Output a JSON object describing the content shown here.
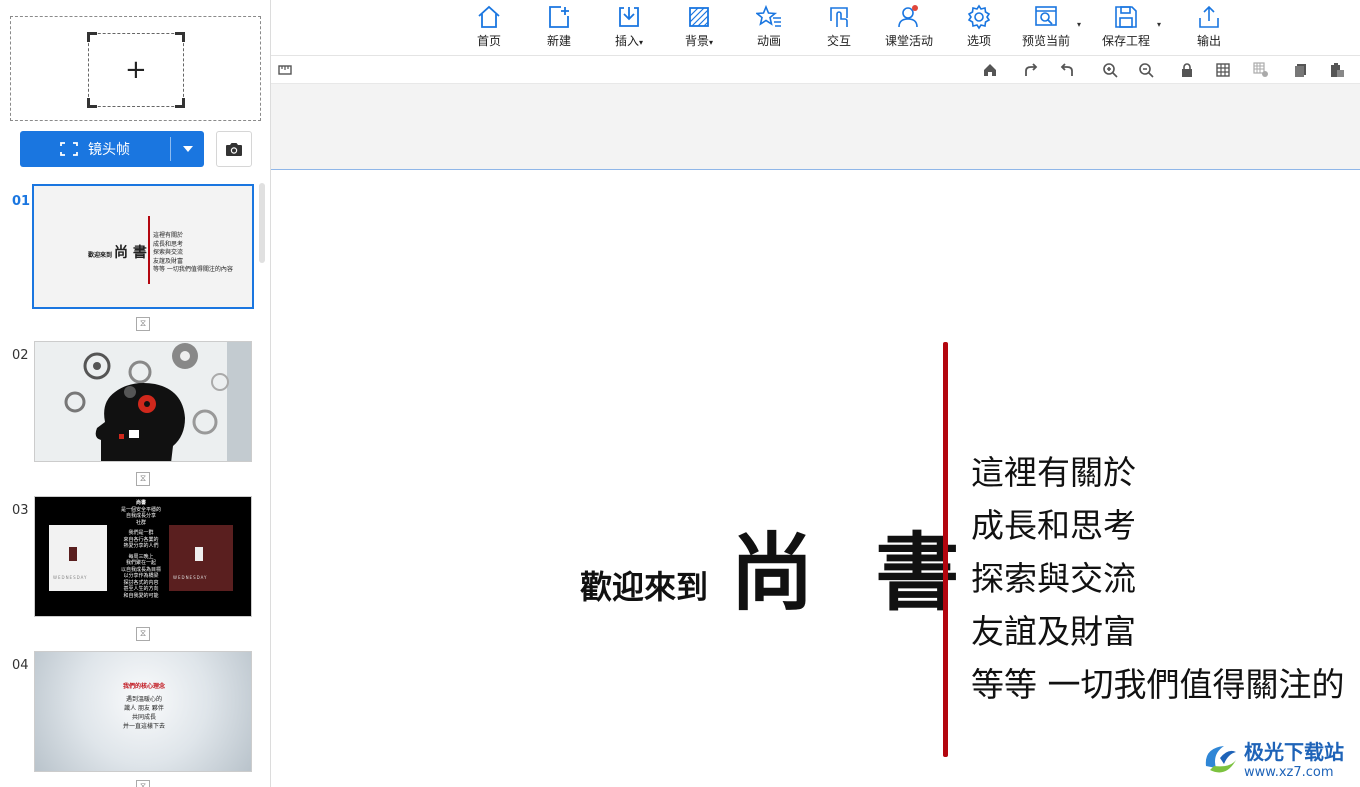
{
  "left_panel": {
    "frame_button_label": "镜头帧",
    "slides": [
      {
        "number": "01",
        "active": true,
        "welcome": "歡迎來到",
        "title": "尚 書",
        "lines": [
          "這裡有關於",
          "成長和思考",
          "探索與交流",
          "友誼及財富",
          "等等 一切我們值得關注的內容"
        ]
      },
      {
        "number": "02",
        "active": false
      },
      {
        "number": "03",
        "active": false,
        "title": "尚書",
        "lines": [
          "是一個安全平穩的",
          "自我成長分享",
          "社群",
          "我們是一群",
          "來自各行各業的",
          "熱愛分享的人們",
          "每周三晚上",
          "我們聚在一起",
          "以自我成長為目標",
          "以分享作為橋梁",
          "探討各式的内容",
          "甚至人生的方向",
          "和自我愛的可能"
        ],
        "card_text": "WEDNESDAY"
      },
      {
        "number": "04",
        "active": false,
        "title": "我們的核心理念",
        "lines": [
          "遇到溫暖心的",
          "識人 朋友 夥伴",
          "共同成長",
          "并一直這樣下去"
        ]
      }
    ]
  },
  "toolbar": {
    "items": [
      {
        "label": "首页",
        "icon": "home-icon"
      },
      {
        "label": "新建",
        "icon": "new-slide-icon"
      },
      {
        "label": "插入",
        "icon": "insert-icon",
        "dropdown": true
      },
      {
        "label": "背景",
        "icon": "background-icon",
        "dropdown": true
      },
      {
        "label": "动画",
        "icon": "animation-icon"
      },
      {
        "label": "交互",
        "icon": "interaction-icon"
      },
      {
        "label": "课堂活动",
        "icon": "classroom-activity-icon"
      },
      {
        "label": "选项",
        "icon": "options-gear-icon"
      },
      {
        "label": "预览当前",
        "icon": "preview-icon",
        "dropdown": true
      },
      {
        "label": "保存工程",
        "icon": "save-icon",
        "dropdown": true
      },
      {
        "label": "输出",
        "icon": "export-icon"
      }
    ]
  },
  "canvas": {
    "welcome": "歡迎來到",
    "title": "尚 書",
    "lines": [
      "這裡有關於",
      "成長和思考",
      "探索與交流",
      "友誼及財富",
      "等等  一切我們值得關注的"
    ]
  },
  "watermark": {
    "name": "极光下载站",
    "url": "www.xz7.com"
  },
  "colors": {
    "accent": "#1a76e0",
    "title_bar": "#b3060f"
  }
}
